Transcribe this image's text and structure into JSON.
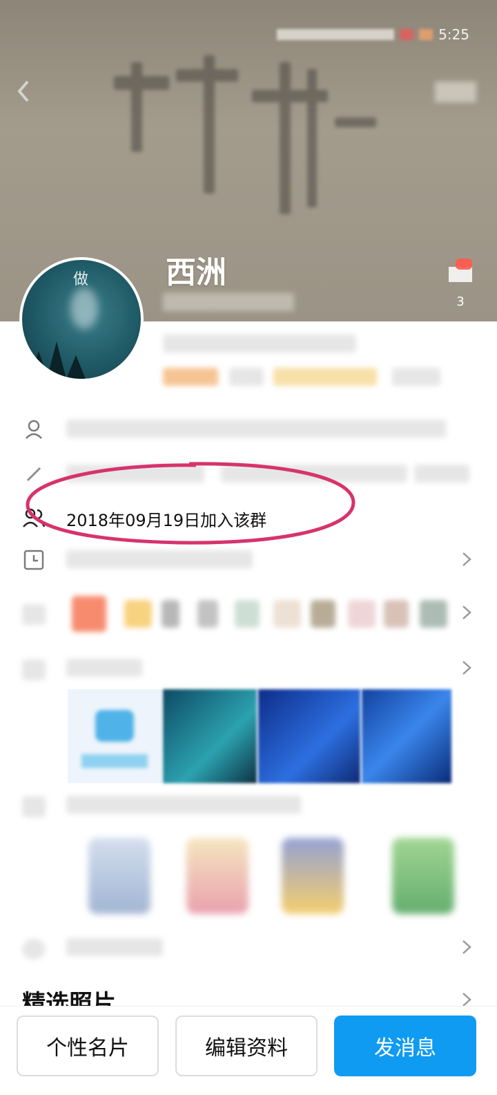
{
  "status_bar": {
    "time": "5:25"
  },
  "profile": {
    "name": "西洲",
    "avatar_text": "做",
    "like_count": "3"
  },
  "details": {
    "join_text": "2018年09月19日加入该群"
  },
  "sections": {
    "featured_photos_title": "精选照片"
  },
  "bottom_bar": {
    "card_label": "个性名片",
    "edit_label": "编辑资料",
    "message_label": "发消息"
  },
  "colors": {
    "primary": "#0f9bf2",
    "annotation": "#d6336c",
    "cover": "#9b9486"
  }
}
